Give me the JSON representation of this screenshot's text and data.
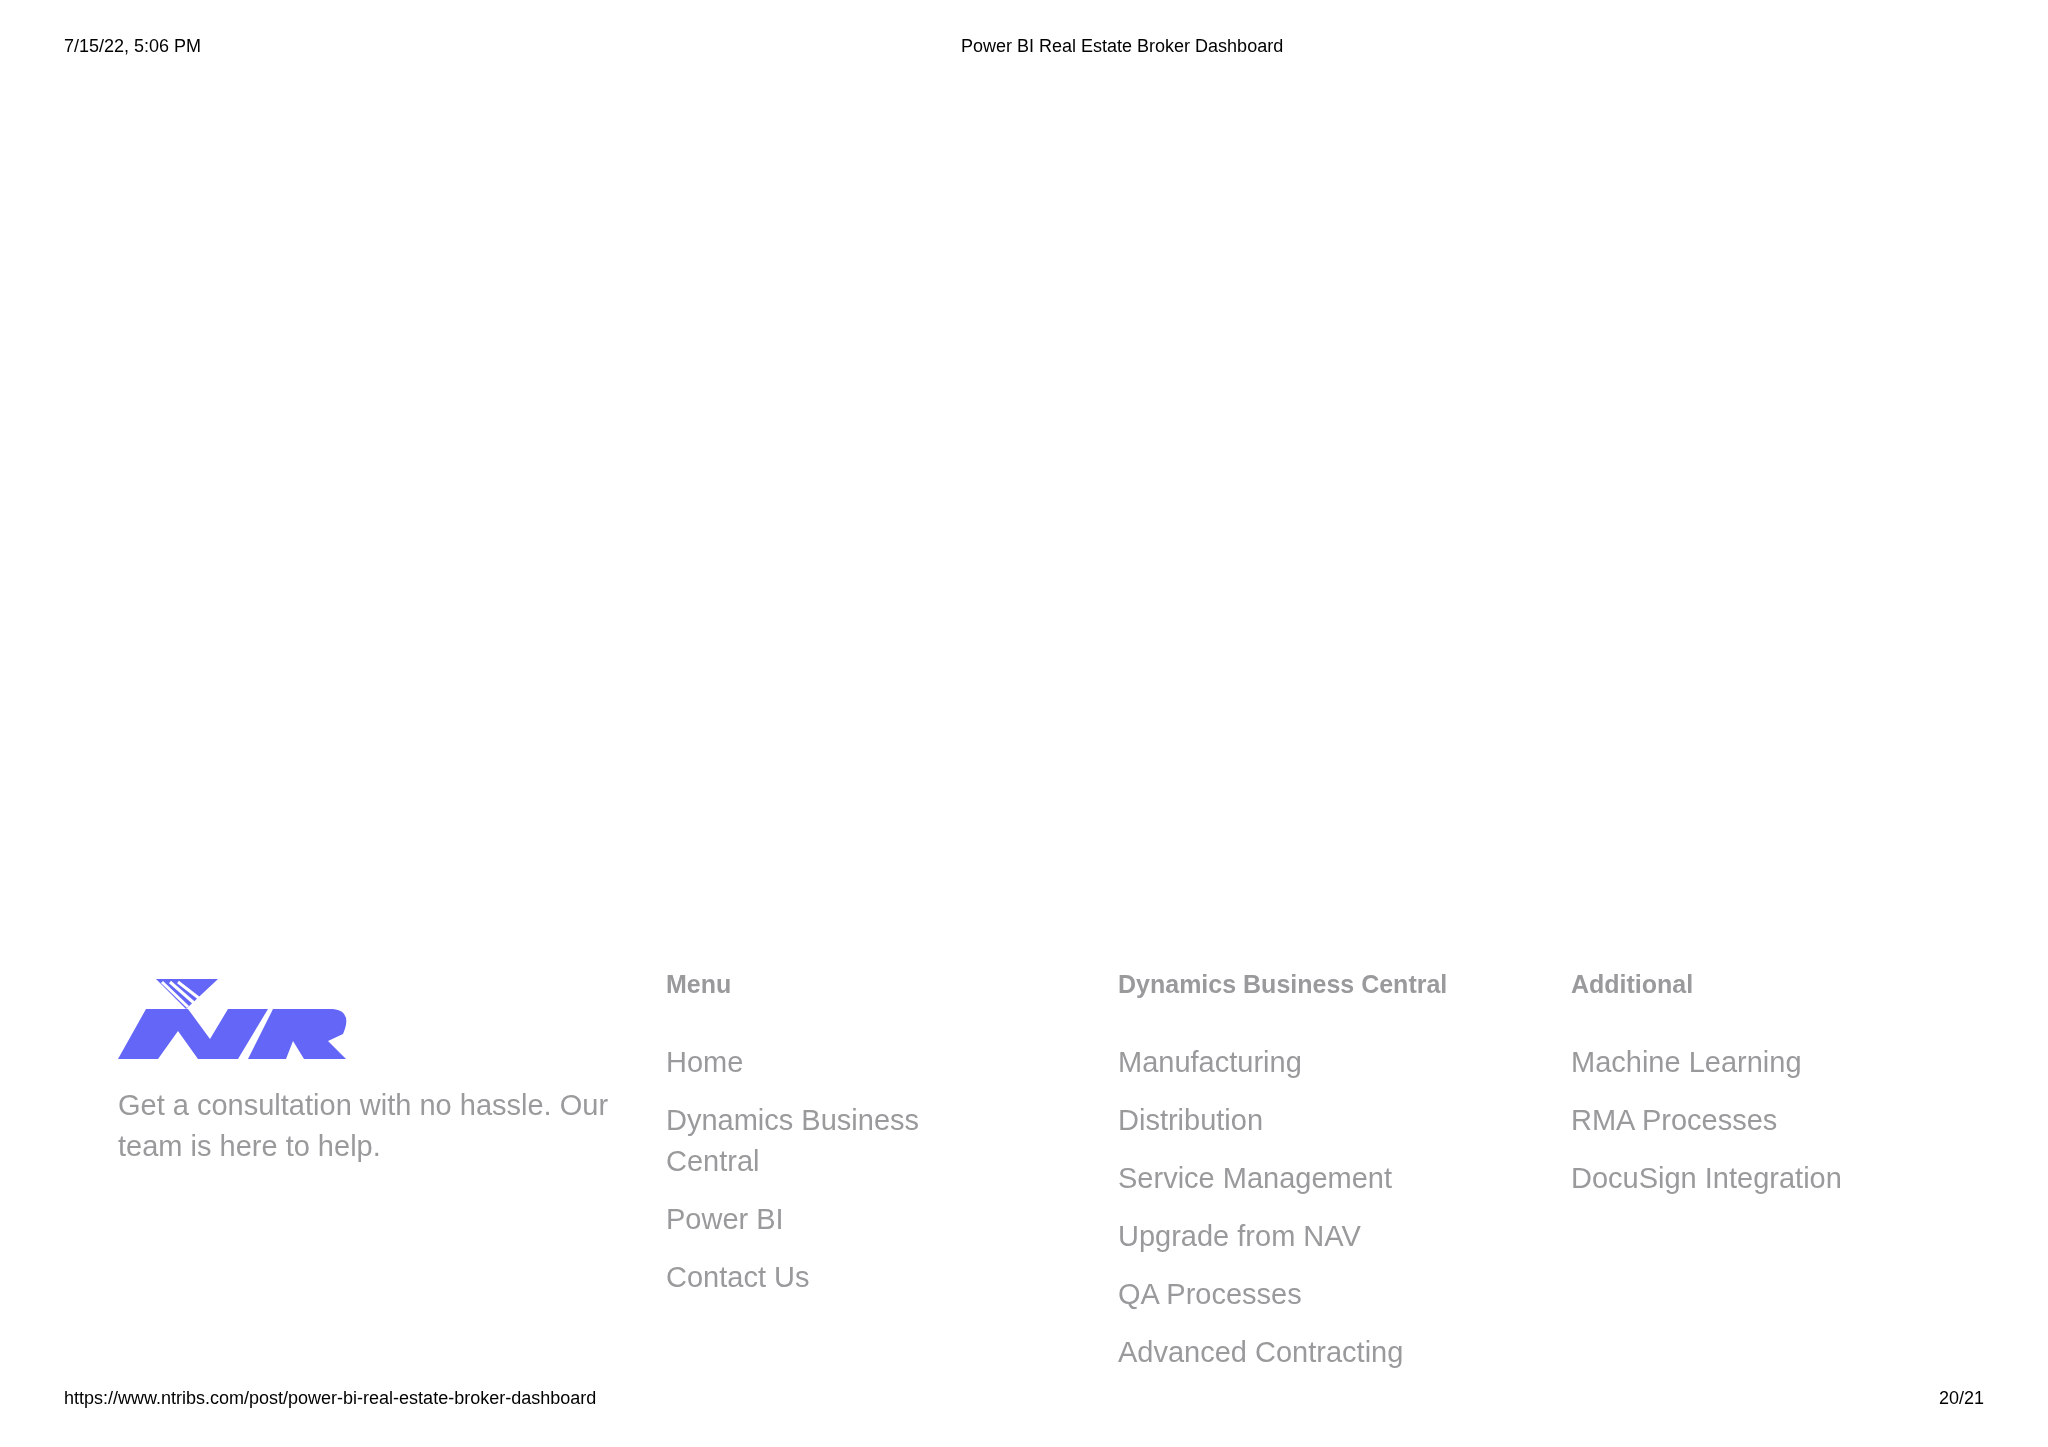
{
  "print_header": {
    "date": "7/15/22, 5:06 PM",
    "title": "Power BI Real Estate Broker Dashboard"
  },
  "footer": {
    "tagline": "Get a consultation with no hassle. Our team is here to help.",
    "columns": [
      {
        "heading": "Menu",
        "links": [
          "Home",
          "Dynamics Business Central",
          "Power BI",
          "Contact Us"
        ]
      },
      {
        "heading": "Dynamics Business Central",
        "links": [
          "Manufacturing",
          "Distribution",
          "Service Management",
          "Upgrade from NAV",
          "QA Processes",
          "Advanced Contracting"
        ]
      },
      {
        "heading": "Additional",
        "links": [
          "Machine Learning",
          "RMA Processes",
          "DocuSign Integration"
        ]
      }
    ]
  },
  "print_footer": {
    "url": "https://www.ntribs.com/post/power-bi-real-estate-broker-dashboard",
    "page": "20/21"
  }
}
